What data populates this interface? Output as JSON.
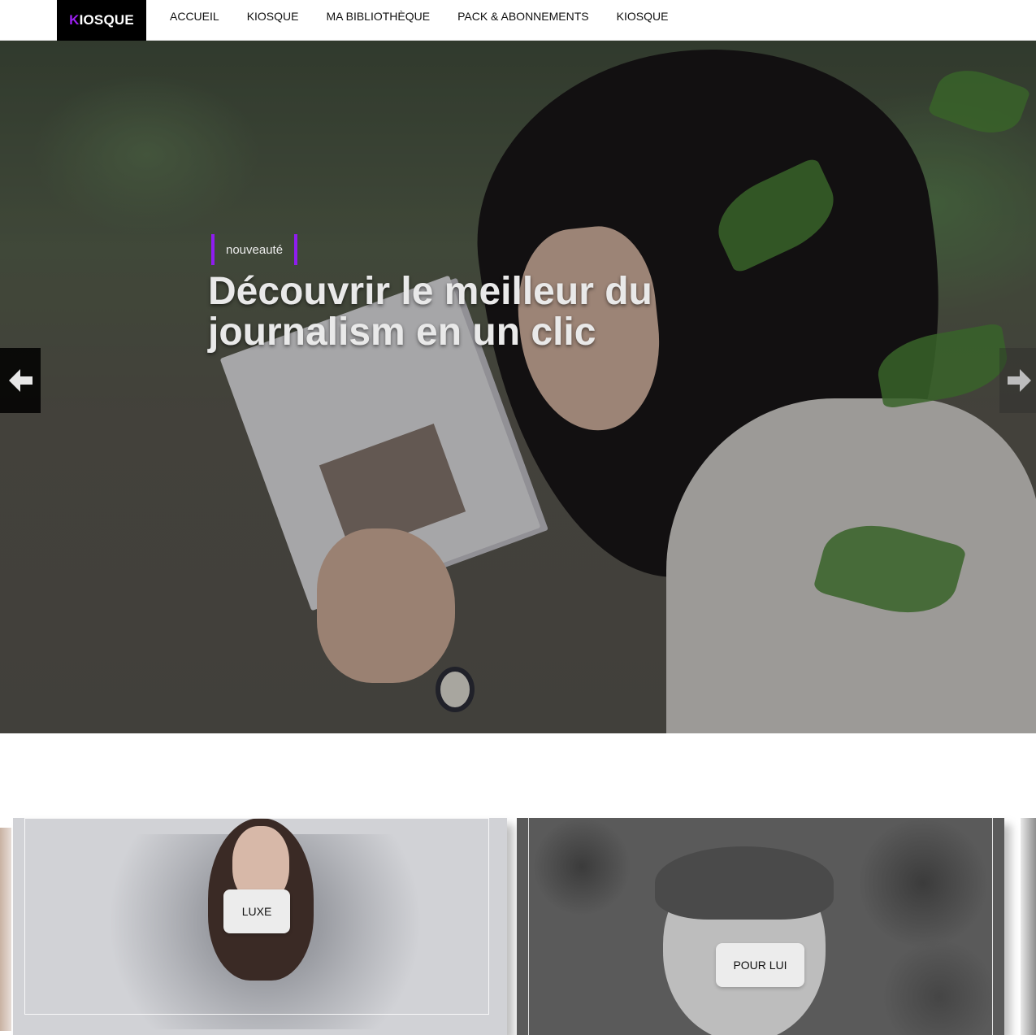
{
  "brand": {
    "first_letter": "K",
    "rest": "IOSQUE"
  },
  "nav": {
    "items": [
      {
        "label": "ACCUEIL"
      },
      {
        "label": "KIOSQUE"
      },
      {
        "label": "MA BIBLIOTHÈQUE"
      },
      {
        "label": "PACK & ABONNEMENTS"
      },
      {
        "label": "KIOSQUE"
      }
    ]
  },
  "hero": {
    "tag": "nouveauté",
    "headline": "Découvrir le meilleur du journalism en un clic",
    "prev_icon": "arrow-left-icon",
    "next_icon": "arrow-right-icon"
  },
  "categories": [
    {
      "label": "LUXE"
    },
    {
      "label": "POUR LUI"
    }
  ],
  "colors": {
    "accent": "#8f1cf0",
    "brand_bg": "#000000"
  }
}
